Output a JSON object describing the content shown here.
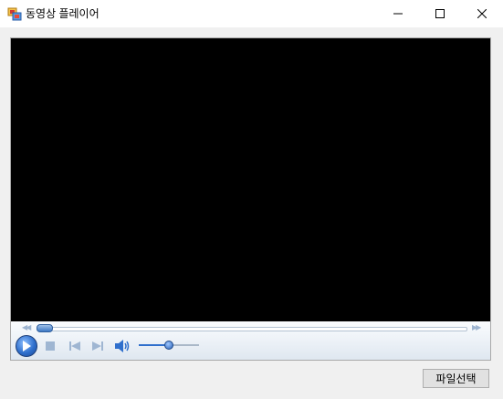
{
  "window": {
    "title": "동영상 플레이어",
    "icon": "app-window-icon",
    "controls": [
      "minimize-icon",
      "maximize-icon",
      "close-icon"
    ]
  },
  "player": {
    "seek": {
      "position": 0.0
    },
    "volume": {
      "level": 0.5
    },
    "icons": [
      "play-icon",
      "stop-icon",
      "previous-icon",
      "next-icon",
      "speaker-icon",
      "rewind-icon",
      "fast-forward-icon"
    ],
    "accent_color": "#2f6fcc"
  },
  "buttons": {
    "select_file": "파일선택"
  }
}
